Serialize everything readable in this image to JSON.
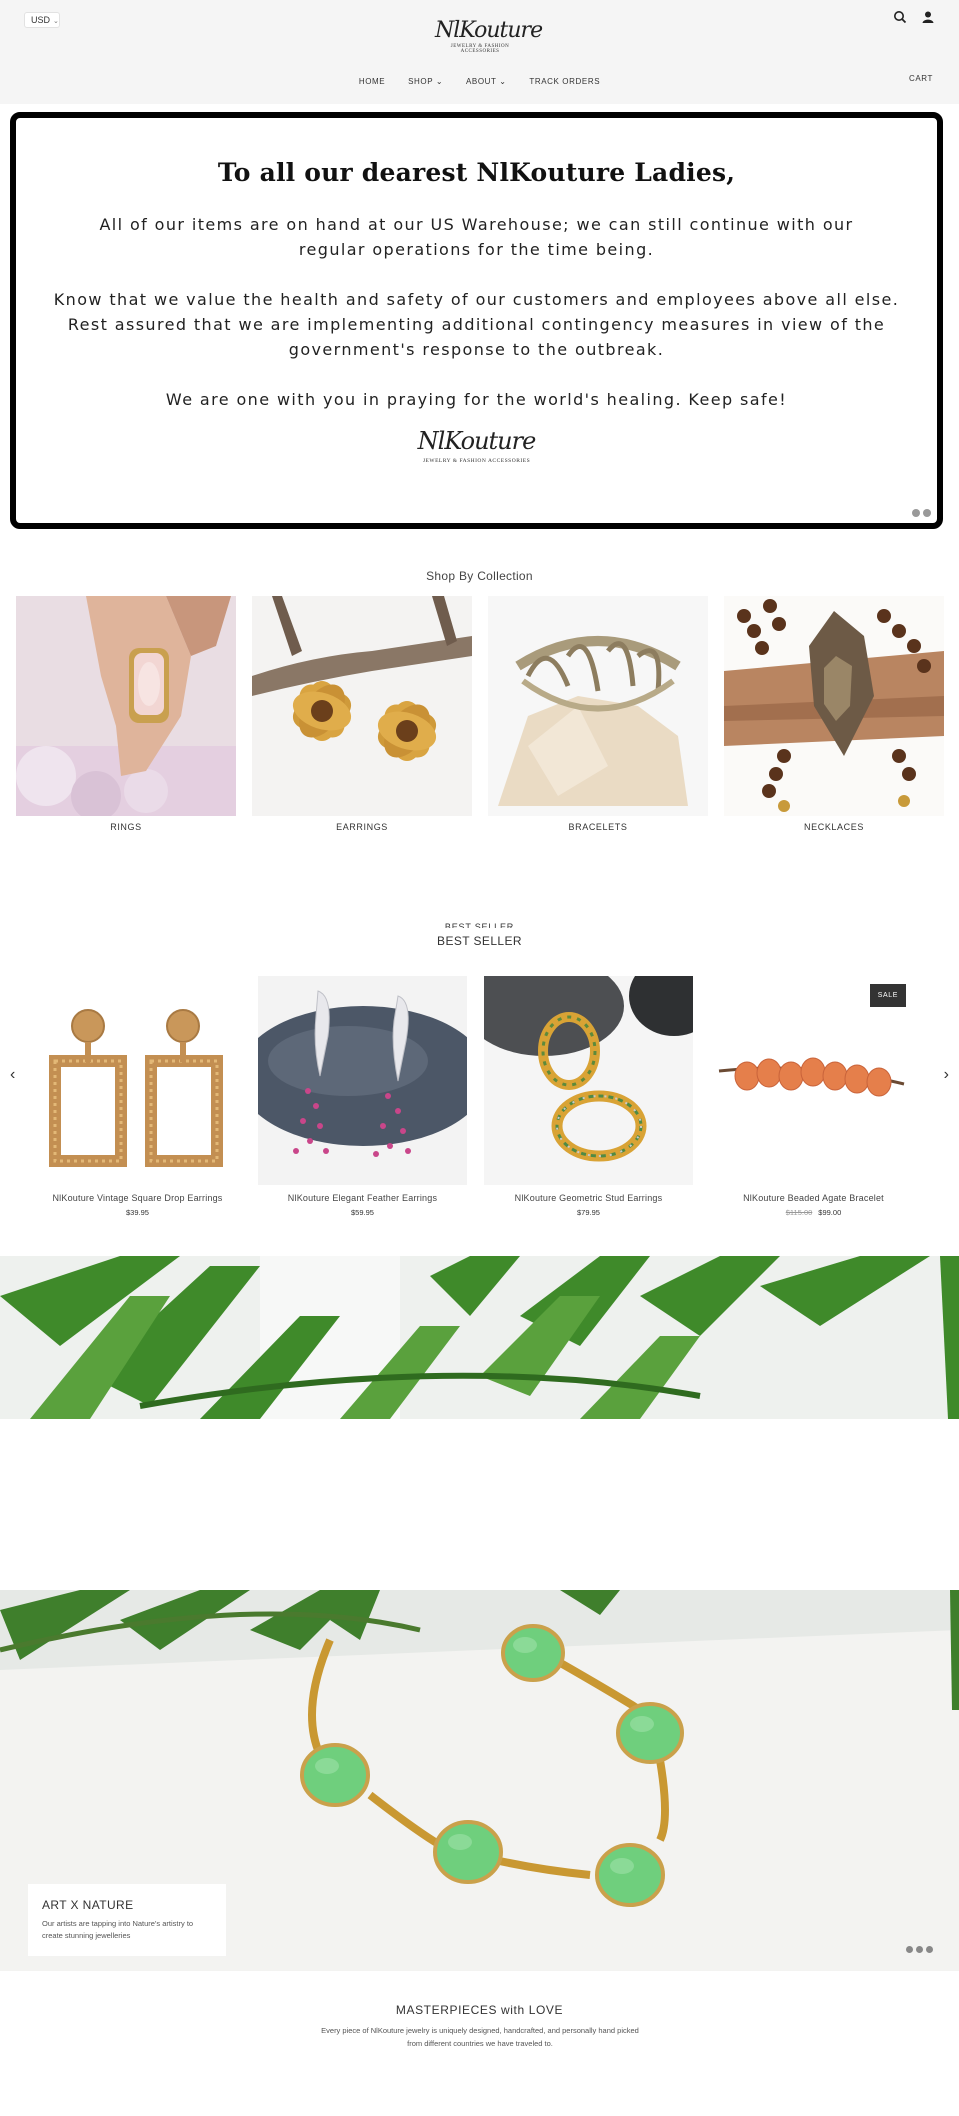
{
  "header": {
    "currency": "USD",
    "logo_text": "NlKouture",
    "logo_tagline": "JEWELRY & FASHION ACCESSORIES",
    "nav": [
      "HOME",
      "SHOP",
      "ABOUT",
      "TRACK ORDERS"
    ],
    "cart_label": "CART",
    "icons": [
      "search-icon",
      "account-icon",
      "chevron-down-icon"
    ]
  },
  "announcement": {
    "title": "To all our dearest NlKouture Ladies,",
    "paragraph_1": "All of our items are on hand at our US Warehouse; we can still continue with our regular operations for the time being.",
    "paragraph_2": "Know that we value the health and safety of our customers and employees above all else. Rest assured that we are implementing additional contingency measures in view of the government's response to the outbreak.",
    "paragraph_3": "We are one with you in praying for the world's healing. Keep safe!",
    "logo_text": "NlKouture",
    "logo_tagline": "JEWELRY & FASHION ACCESSORIES"
  },
  "collections": {
    "title": "Shop By Collection",
    "items": [
      {
        "label": "RINGS"
      },
      {
        "label": "EARRINGS"
      },
      {
        "label": "BRACELETS"
      },
      {
        "label": "NECKLACES"
      }
    ]
  },
  "best_seller": {
    "title": "BEST SELLER",
    "products": [
      {
        "name": "NlKouture Vintage Square Drop Earrings",
        "price": "$39.95",
        "old_price": null,
        "sale": false
      },
      {
        "name": "NlKouture Elegant Feather Earrings",
        "price": "$59.95",
        "old_price": null,
        "sale": false
      },
      {
        "name": "NlKouture Geometric Stud Earrings",
        "price": "$79.95",
        "old_price": null,
        "sale": false
      },
      {
        "name": "NlKouture Beaded Agate Bracelet",
        "price": "$99.00",
        "old_price": "$115.00",
        "sale": true,
        "sale_label": "SALE"
      }
    ]
  },
  "hero": {
    "heading": "ART X NATURE",
    "text": "Our artists are tapping into Nature's artistry to create stunning jewelleries"
  },
  "masterpieces": {
    "title": "MASTERPIECES with LOVE",
    "text": "Every piece of NlKouture jewelry is uniquely designed, handcrafted, and personally hand picked from different countries we have traveled to."
  },
  "colors": {
    "header_bg": "#f5f5f5",
    "announcement_border": "#000000",
    "sale_badge": "#333333"
  }
}
